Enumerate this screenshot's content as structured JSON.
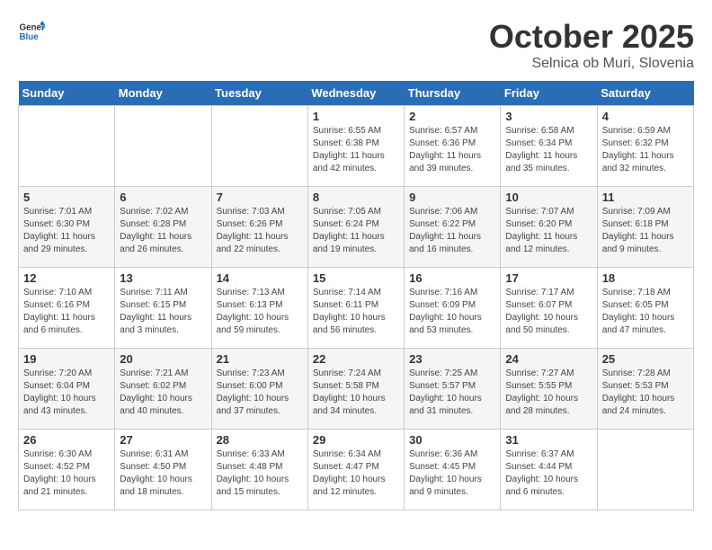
{
  "header": {
    "logo_general": "General",
    "logo_blue": "Blue",
    "month": "October 2025",
    "location": "Selnica ob Muri, Slovenia"
  },
  "weekdays": [
    "Sunday",
    "Monday",
    "Tuesday",
    "Wednesday",
    "Thursday",
    "Friday",
    "Saturday"
  ],
  "weeks": [
    [
      {
        "day": "",
        "info": ""
      },
      {
        "day": "",
        "info": ""
      },
      {
        "day": "",
        "info": ""
      },
      {
        "day": "1",
        "info": "Sunrise: 6:55 AM\nSunset: 6:38 PM\nDaylight: 11 hours\nand 42 minutes."
      },
      {
        "day": "2",
        "info": "Sunrise: 6:57 AM\nSunset: 6:36 PM\nDaylight: 11 hours\nand 39 minutes."
      },
      {
        "day": "3",
        "info": "Sunrise: 6:58 AM\nSunset: 6:34 PM\nDaylight: 11 hours\nand 35 minutes."
      },
      {
        "day": "4",
        "info": "Sunrise: 6:59 AM\nSunset: 6:32 PM\nDaylight: 11 hours\nand 32 minutes."
      }
    ],
    [
      {
        "day": "5",
        "info": "Sunrise: 7:01 AM\nSunset: 6:30 PM\nDaylight: 11 hours\nand 29 minutes."
      },
      {
        "day": "6",
        "info": "Sunrise: 7:02 AM\nSunset: 6:28 PM\nDaylight: 11 hours\nand 26 minutes."
      },
      {
        "day": "7",
        "info": "Sunrise: 7:03 AM\nSunset: 6:26 PM\nDaylight: 11 hours\nand 22 minutes."
      },
      {
        "day": "8",
        "info": "Sunrise: 7:05 AM\nSunset: 6:24 PM\nDaylight: 11 hours\nand 19 minutes."
      },
      {
        "day": "9",
        "info": "Sunrise: 7:06 AM\nSunset: 6:22 PM\nDaylight: 11 hours\nand 16 minutes."
      },
      {
        "day": "10",
        "info": "Sunrise: 7:07 AM\nSunset: 6:20 PM\nDaylight: 11 hours\nand 12 minutes."
      },
      {
        "day": "11",
        "info": "Sunrise: 7:09 AM\nSunset: 6:18 PM\nDaylight: 11 hours\nand 9 minutes."
      }
    ],
    [
      {
        "day": "12",
        "info": "Sunrise: 7:10 AM\nSunset: 6:16 PM\nDaylight: 11 hours\nand 6 minutes."
      },
      {
        "day": "13",
        "info": "Sunrise: 7:11 AM\nSunset: 6:15 PM\nDaylight: 11 hours\nand 3 minutes."
      },
      {
        "day": "14",
        "info": "Sunrise: 7:13 AM\nSunset: 6:13 PM\nDaylight: 10 hours\nand 59 minutes."
      },
      {
        "day": "15",
        "info": "Sunrise: 7:14 AM\nSunset: 6:11 PM\nDaylight: 10 hours\nand 56 minutes."
      },
      {
        "day": "16",
        "info": "Sunrise: 7:16 AM\nSunset: 6:09 PM\nDaylight: 10 hours\nand 53 minutes."
      },
      {
        "day": "17",
        "info": "Sunrise: 7:17 AM\nSunset: 6:07 PM\nDaylight: 10 hours\nand 50 minutes."
      },
      {
        "day": "18",
        "info": "Sunrise: 7:18 AM\nSunset: 6:05 PM\nDaylight: 10 hours\nand 47 minutes."
      }
    ],
    [
      {
        "day": "19",
        "info": "Sunrise: 7:20 AM\nSunset: 6:04 PM\nDaylight: 10 hours\nand 43 minutes."
      },
      {
        "day": "20",
        "info": "Sunrise: 7:21 AM\nSunset: 6:02 PM\nDaylight: 10 hours\nand 40 minutes."
      },
      {
        "day": "21",
        "info": "Sunrise: 7:23 AM\nSunset: 6:00 PM\nDaylight: 10 hours\nand 37 minutes."
      },
      {
        "day": "22",
        "info": "Sunrise: 7:24 AM\nSunset: 5:58 PM\nDaylight: 10 hours\nand 34 minutes."
      },
      {
        "day": "23",
        "info": "Sunrise: 7:25 AM\nSunset: 5:57 PM\nDaylight: 10 hours\nand 31 minutes."
      },
      {
        "day": "24",
        "info": "Sunrise: 7:27 AM\nSunset: 5:55 PM\nDaylight: 10 hours\nand 28 minutes."
      },
      {
        "day": "25",
        "info": "Sunrise: 7:28 AM\nSunset: 5:53 PM\nDaylight: 10 hours\nand 24 minutes."
      }
    ],
    [
      {
        "day": "26",
        "info": "Sunrise: 6:30 AM\nSunset: 4:52 PM\nDaylight: 10 hours\nand 21 minutes."
      },
      {
        "day": "27",
        "info": "Sunrise: 6:31 AM\nSunset: 4:50 PM\nDaylight: 10 hours\nand 18 minutes."
      },
      {
        "day": "28",
        "info": "Sunrise: 6:33 AM\nSunset: 4:48 PM\nDaylight: 10 hours\nand 15 minutes."
      },
      {
        "day": "29",
        "info": "Sunrise: 6:34 AM\nSunset: 4:47 PM\nDaylight: 10 hours\nand 12 minutes."
      },
      {
        "day": "30",
        "info": "Sunrise: 6:36 AM\nSunset: 4:45 PM\nDaylight: 10 hours\nand 9 minutes."
      },
      {
        "day": "31",
        "info": "Sunrise: 6:37 AM\nSunset: 4:44 PM\nDaylight: 10 hours\nand 6 minutes."
      },
      {
        "day": "",
        "info": ""
      }
    ]
  ]
}
